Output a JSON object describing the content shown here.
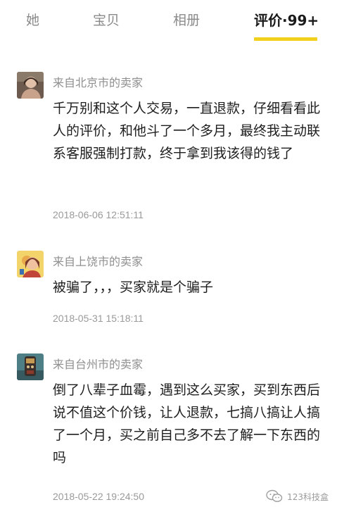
{
  "tabs": [
    {
      "label": "她"
    },
    {
      "label": "宝贝"
    },
    {
      "label": "相册"
    },
    {
      "label": "评价·99+"
    }
  ],
  "active_tab": "评价·99+",
  "accent_color": "#f2d11e",
  "reviews": [
    {
      "author": "来自北京市的卖家",
      "content": "千万别和这个人交易，一直退款，仔细看看此人的评价，和他斗了一个多月，最终我主动联系客服强制打款，终于拿到我该得的钱了",
      "date": "2018-06-06 12:51:11"
    },
    {
      "author": "来自上饶市的卖家",
      "content": "被骗了，，，买家就是个骗子",
      "date": "2018-05-31 15:18:11"
    },
    {
      "author": "来自台州市的卖家",
      "content": "倒了八辈子血霉，遇到这么买家，买到东西后说不值这个价钱，让人退款，七搞八搞让人搞了一个月，买之前自己多不去了解一下东西的吗",
      "date": "2018-05-22 19:24:50"
    }
  ],
  "watermark": {
    "text": "123科技盒"
  }
}
